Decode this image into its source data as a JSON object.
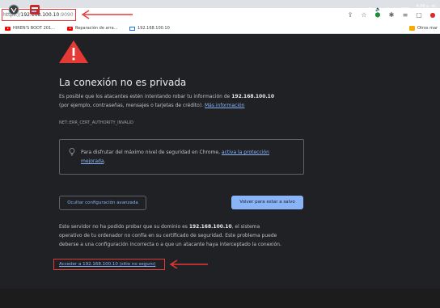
{
  "browser": {
    "url_scheme": "https://",
    "url_host": "192.168.100.10",
    "url_port": ":9090",
    "bookmarks": [
      {
        "label": "HIREN'S BOOT 201...",
        "icon": "youtube-icon"
      },
      {
        "label": "Reparación de arra...",
        "icon": "youtube-icon"
      },
      {
        "label": "192.168.100.10",
        "icon": "monitor-icon"
      }
    ],
    "other_bookmarks": "Otros mar"
  },
  "page": {
    "title": "La conexión no es privada",
    "para1_line1_pre": "Es posible que los atacantes estén intentando robar tu información de ",
    "para1_host": "192.168.100.10",
    "para1_line2": "(por ejemplo, contraseñas, mensajes o tarjetas de crédito).",
    "more_info_link": "Más información",
    "error_code": "NET::ERR_CERT_AUTHORITY_INVALID",
    "protection_text": "Para disfrutar del máximo nivel de seguridad en Chrome,",
    "protection_link_1": "activa la protección",
    "protection_link_2": "mejorada",
    "protection_end": ".",
    "advanced_button": "Ocultar configuración avanzada",
    "back_button": "Volver para estar a salvo",
    "advanced_line1_pre": "Este servidor no ha podido probar que su dominio es ",
    "advanced_host": "192.168.100.10",
    "advanced_line1_post": ", el sistema",
    "advanced_line2": "operativo de tu ordenador no confía en su certificado de seguridad. Este problema puede",
    "advanced_line3": "deberse a una configuración incorrecta o a que un atacante haya interceptado la conexión.",
    "proceed_link": "Acceder a 192.168.100.10 (sitio no seguro)"
  },
  "taskbar": {
    "language": "ESP",
    "time": "4:58 p. m.",
    "date": "10/12/2022"
  },
  "colors": {
    "background": "#202124",
    "link": "#8ab4f8",
    "annotation_red": "#e53935",
    "warning_red": "#e53935"
  }
}
